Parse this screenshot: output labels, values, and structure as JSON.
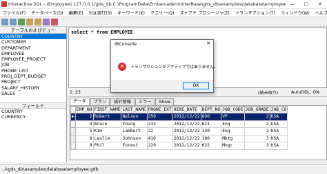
{
  "window": {
    "title": "Interactive SQL - (Employee) 127.0.0.1/gds_db:C:\\ProgramData\\Embarcadero\\InterBase\\gds_db\\examples\\database\\employee.gdb",
    "minimize": "—",
    "maximize": "□",
    "close": "✕"
  },
  "menu": [
    "ファイル(F)",
    "データベース(D)",
    "編集(E)",
    "SQL実行(S)",
    "キーワード(K)",
    "クエリー(Q)",
    "ストアド プロシージャ(Z)",
    "トランザクション(T)",
    "ウィンドウ(W)",
    "ヘルプ(H)"
  ],
  "left_panel": {
    "tables_header": "テーブルおよびビュー",
    "tables": [
      "COUNTRY",
      "CUSTOMER",
      "DEPARTMENT",
      "EMPLOYEE",
      "EMPLOYEE_PROJECT",
      "JOB",
      "PHONE_LIST",
      "PROJ_DEPT_BUDGET",
      "PROJECT",
      "SALARY_HISTORY",
      "SALES"
    ],
    "fields_header": "フィールド",
    "fields": [
      "COUNTRY",
      "CURRENCY"
    ]
  },
  "editor": {
    "sql": "select * from EMPLOYEE"
  },
  "status": {
    "position": "1: 23",
    "read_only": "(読み取り)",
    "autoddl": "AutoDDL: ON"
  },
  "tabs": [
    "データ",
    "プラン",
    "統計情報",
    "エラー",
    "Show"
  ],
  "grid": {
    "columns": [
      "EMP_NO",
      "FIRST_NAME",
      "LAST_NAME",
      "PHONE_EXT",
      "HIRE_DATE",
      "DEPT_NO",
      "JOB_CODE",
      "JOB_GRADE",
      "JOB_CO"
    ],
    "rows": [
      [
        "2",
        "Robert",
        "Nelson",
        "250",
        "2012/12/22",
        "600",
        "VP",
        "2",
        "USA"
      ],
      [
        "4",
        "Bruce",
        "Young",
        "233",
        "2012/12/22",
        "621",
        "Eng",
        "2",
        "USA"
      ],
      [
        "5",
        "Kim",
        "Lambert",
        "22",
        "2012/12/22",
        "130",
        "Eng",
        "2",
        "USA"
      ],
      [
        "8",
        "Leslie",
        "Johnson",
        "410",
        "2012/12/22",
        "180",
        "Mktg",
        "3",
        "USA"
      ],
      [
        "9",
        "Phil",
        "Forest",
        "229",
        "2012/12/22",
        "622",
        "Mngr",
        "3",
        "USA"
      ]
    ],
    "selected_row": 0
  },
  "bottom_status": "...kgds_db\\examples\\database\\employee.gdb",
  "dialog": {
    "title": "IBConsole",
    "close": "✕",
    "icon_glyph": "✕",
    "message": "トランザクションがアクティブではありません。",
    "ok": "OK"
  },
  "colors": {
    "selection": "#0078d7",
    "grid_selection": "#0a246a",
    "error": "#d32f2f"
  }
}
